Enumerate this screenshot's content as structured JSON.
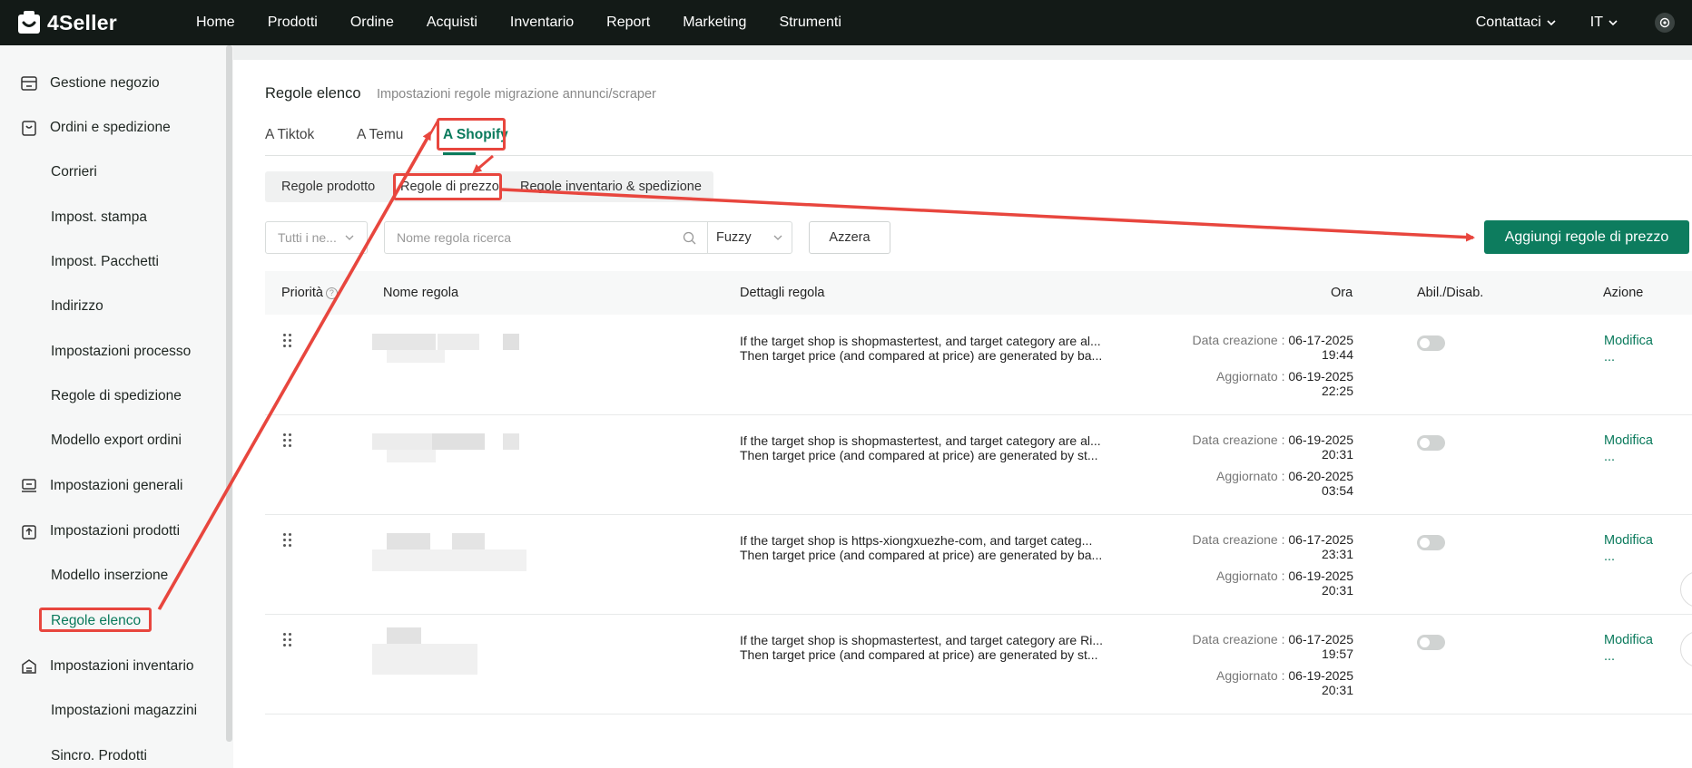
{
  "app": {
    "name": "4Seller"
  },
  "nav": {
    "items": [
      "Home",
      "Prodotti",
      "Ordine",
      "Acquisti",
      "Inventario",
      "Report",
      "Marketing",
      "Strumenti"
    ],
    "contact_label": "Contattaci",
    "language": "IT"
  },
  "sidebar": {
    "items": [
      {
        "label": "Gestione negozio",
        "icon": "store-icon",
        "level": "parent"
      },
      {
        "label": "Ordini e spedizione",
        "icon": "order-icon",
        "level": "parent"
      },
      {
        "label": "Corrieri",
        "level": "child"
      },
      {
        "label": "Impost. stampa",
        "level": "child"
      },
      {
        "label": "Impost. Pacchetti",
        "level": "child"
      },
      {
        "label": "Indirizzo",
        "level": "child"
      },
      {
        "label": "Impostazioni processo",
        "level": "child"
      },
      {
        "label": "Regole di spedizione",
        "level": "child"
      },
      {
        "label": "Modello export ordini",
        "level": "child"
      },
      {
        "label": "Impostazioni generali",
        "icon": "settings-icon",
        "level": "parent"
      },
      {
        "label": "Impostazioni prodotti",
        "icon": "product-icon",
        "level": "parent"
      },
      {
        "label": "Modello inserzione",
        "level": "child"
      },
      {
        "label": "Regole elenco",
        "level": "child",
        "active": true
      },
      {
        "label": "Impostazioni inventario",
        "icon": "inventory-icon",
        "level": "parent"
      },
      {
        "label": "Impostazioni magazzini",
        "level": "child"
      },
      {
        "label": "Sincro. Prodotti",
        "level": "child"
      }
    ]
  },
  "page": {
    "title": "Regole elenco",
    "subtitle": "Impostazioni regole migrazione annunci/scraper",
    "tabs": [
      "A Tiktok",
      "A Temu",
      "A Shopify"
    ],
    "active_tab": "A Shopify",
    "subtabs": [
      "Regole prodotto",
      "Regole di prezzo",
      "Regole inventario & spedizione"
    ],
    "active_subtab": "Regole di prezzo"
  },
  "filters": {
    "select_placeholder": "Tutti i ne...",
    "search_placeholder": "Nome regola ricerca",
    "match_mode": "Fuzzy",
    "reset_label": "Azzera",
    "add_label": "Aggiungi regole di prezzo"
  },
  "table": {
    "columns": {
      "priority": "Priorità",
      "name": "Nome regola",
      "details": "Dettagli regola",
      "time": "Ora",
      "toggle": "Abil./Disab.",
      "action": "Azione"
    },
    "created_label": "Data creazione :",
    "updated_label": "Aggiornato :",
    "edit_label": "Modifica",
    "more_label": "...",
    "rows": [
      {
        "detail_1": "If the target shop is shopmastertest, and target category are al...",
        "detail_2": "Then target price (and compared at price) are generated by ba...",
        "created_date": "06-17-2025",
        "created_time": "19:44",
        "updated_date": "06-19-2025",
        "updated_time": "22:25",
        "enabled": false
      },
      {
        "detail_1": "If the target shop is shopmastertest, and target category are al...",
        "detail_2": "Then target price (and compared at price) are generated by st...",
        "created_date": "06-19-2025",
        "created_time": "20:31",
        "updated_date": "06-20-2025",
        "updated_time": "03:54",
        "enabled": false
      },
      {
        "detail_1": "If the target shop is https-xiongxuezhe-com, and target categ...",
        "detail_2": "Then target price (and compared at price) are generated by ba...",
        "created_date": "06-17-2025",
        "created_time": "23:31",
        "updated_date": "06-19-2025",
        "updated_time": "20:31",
        "enabled": false
      },
      {
        "detail_1": "If the target shop is shopmastertest, and target category are Ri...",
        "detail_2": "Then target price (and compared at price) are generated by st...",
        "created_date": "06-17-2025",
        "created_time": "19:57",
        "updated_date": "06-19-2025",
        "updated_time": "20:31",
        "enabled": false
      }
    ]
  },
  "colors": {
    "accent": "#0a7a5c",
    "topbar": "#131a17",
    "annotation": "#e8463e"
  }
}
